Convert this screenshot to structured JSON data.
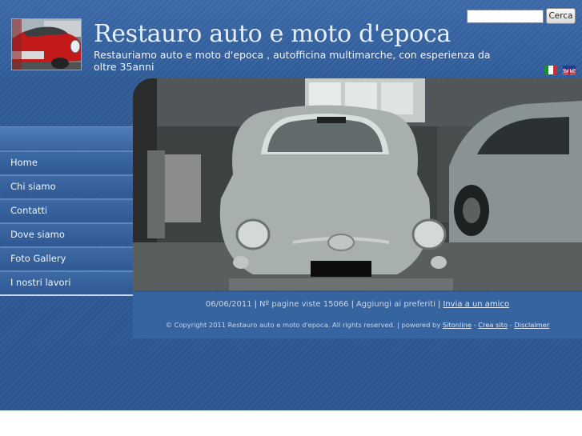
{
  "header": {
    "title": "Restauro auto e moto d'epoca",
    "subtitle": "Restauriamo auto e moto d'epoca , autofficina multimarche, con esperienza da oltre 35anni",
    "logo_icon": "vintage-red-car-photo"
  },
  "search": {
    "value": "",
    "placeholder": "",
    "button_label": "Cerca"
  },
  "languages": [
    {
      "code": "it",
      "icon": "italy-flag-icon"
    },
    {
      "code": "en",
      "icon": "uk-flag-icon"
    }
  ],
  "nav": {
    "items": [
      {
        "label": "Home"
      },
      {
        "label": "Chi siamo"
      },
      {
        "label": "Contatti"
      },
      {
        "label": "Dove siamo"
      },
      {
        "label": "Foto Gallery"
      },
      {
        "label": "I nostri lavori"
      }
    ]
  },
  "hero": {
    "image": "white-fiat-500-in-garage-photo"
  },
  "footer": {
    "date": "06/06/2011",
    "page_views": "Nº pagine viste 15066",
    "favorites": "Aggiungi ai preferiti",
    "invite": "Invia a un amico",
    "copyright": "© Copyright 2011 Restauro auto e moto d'epoca. All rights reserved. | powered by",
    "powered_link": "Sitonline",
    "create_link": "Crea sito",
    "disclaimer_link": "Disclaimer",
    "separator": "-"
  },
  "colors": {
    "page_blue": "#2f5a94",
    "nav_blue": "#3d69a5",
    "footer_panel": "#3564a0",
    "text_light": "#eef3fb"
  }
}
